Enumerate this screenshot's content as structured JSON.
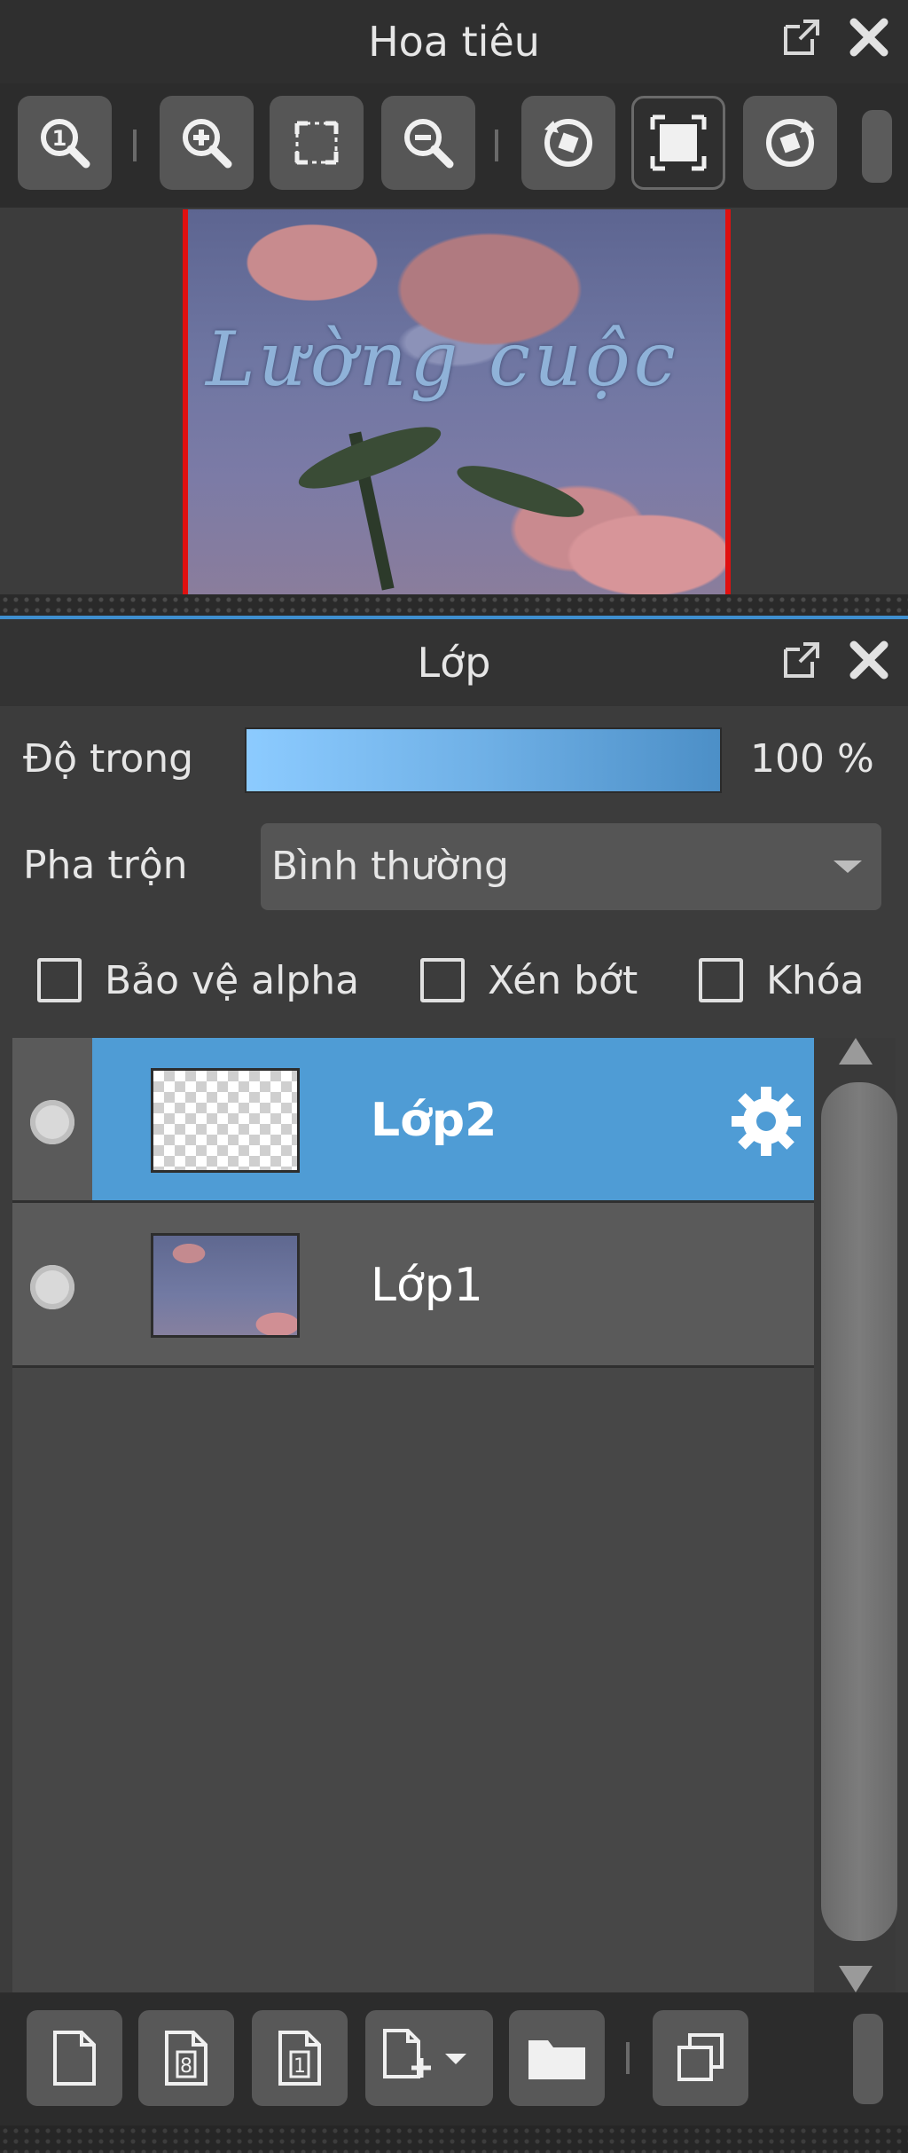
{
  "navigator": {
    "title": "Hoa tiêu",
    "tools": [
      {
        "icon": "zoom-actual-icon"
      },
      {
        "icon": "zoom-in-icon"
      },
      {
        "icon": "fit-to-window-icon"
      },
      {
        "icon": "zoom-out-icon"
      },
      {
        "icon": "rotate-left-icon"
      },
      {
        "icon": "reset-rotation-icon"
      },
      {
        "icon": "rotate-right-icon"
      }
    ],
    "preview_text": "Lường cuộc"
  },
  "layers": {
    "title": "Lớp",
    "opacity_label": "Độ trong",
    "opacity_value": "100 %",
    "opacity_fraction": 1.0,
    "blend_label": "Pha trộn",
    "blend_value": "Bình thường",
    "options": [
      {
        "label": "Bảo vệ alpha",
        "checked": false
      },
      {
        "label": "Xén bớt",
        "checked": false
      },
      {
        "label": "Khóa",
        "checked": false
      }
    ],
    "items": [
      {
        "name": "Lớp2",
        "selected": true,
        "visible": true
      },
      {
        "name": "Lớp1",
        "selected": false,
        "visible": true
      }
    ]
  },
  "colors": {
    "accent": "#4f9cd5",
    "opacity_gradient_start": "#8ccbff",
    "opacity_gradient_end": "#4c8fc7",
    "frame_red": "#e01010"
  }
}
